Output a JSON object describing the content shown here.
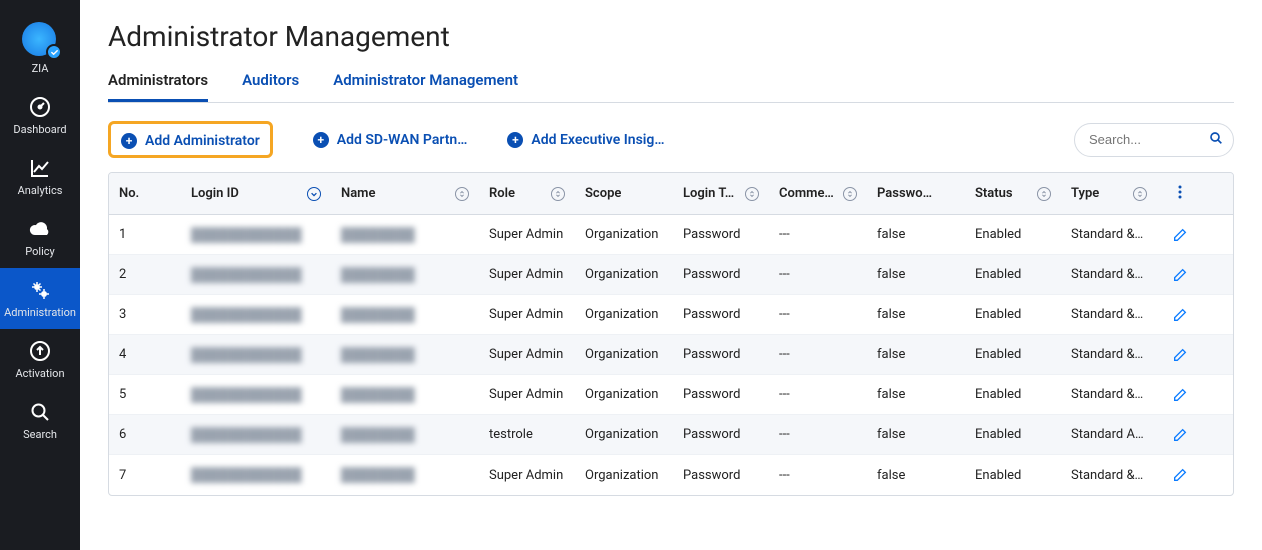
{
  "brand": "ZIA",
  "sidebar": [
    {
      "key": "zia",
      "label": "ZIA",
      "icon": "globe-check-icon",
      "active": false
    },
    {
      "key": "dashboard",
      "label": "Dashboard",
      "icon": "gauge-icon",
      "active": false
    },
    {
      "key": "analytics",
      "label": "Analytics",
      "icon": "chart-line-icon",
      "active": false
    },
    {
      "key": "policy",
      "label": "Policy",
      "icon": "cloud-icon",
      "active": false
    },
    {
      "key": "administration",
      "label": "Administration",
      "icon": "gears-icon",
      "active": true
    },
    {
      "key": "activation",
      "label": "Activation",
      "icon": "upload-circle-icon",
      "active": false
    },
    {
      "key": "search",
      "label": "Search",
      "icon": "search-icon",
      "active": false
    }
  ],
  "page_title": "Administrator Management",
  "tabs": [
    {
      "key": "administrators",
      "label": "Administrators",
      "active": true
    },
    {
      "key": "auditors",
      "label": "Auditors",
      "active": false
    },
    {
      "key": "admin_mgmt",
      "label": "Administrator Management",
      "active": false
    }
  ],
  "actions": {
    "add_admin": "Add Administrator",
    "add_sdwan": "Add SD-WAN Partn…",
    "add_exec": "Add Executive Insig…"
  },
  "search": {
    "placeholder": "Search..."
  },
  "columns": [
    {
      "key": "no",
      "label": "No."
    },
    {
      "key": "login_id",
      "label": "Login ID",
      "sort": "down"
    },
    {
      "key": "name",
      "label": "Name",
      "sort": "neutral"
    },
    {
      "key": "role",
      "label": "Role",
      "sort": "neutral"
    },
    {
      "key": "scope",
      "label": "Scope"
    },
    {
      "key": "login_t",
      "label": "Login T…",
      "sort": "neutral"
    },
    {
      "key": "comme",
      "label": "Comme…",
      "sort": "neutral"
    },
    {
      "key": "passwo",
      "label": "Passwo…"
    },
    {
      "key": "status",
      "label": "Status",
      "sort": "neutral"
    },
    {
      "key": "type",
      "label": "Type",
      "sort": "neutral"
    }
  ],
  "rows": [
    {
      "no": "1",
      "login_id": "████████████",
      "name": "████████",
      "role": "Super Admin",
      "scope": "Organization",
      "login_t": "Password",
      "comme": "---",
      "passwo": "false",
      "status": "Enabled",
      "type": "Standard &…"
    },
    {
      "no": "2",
      "login_id": "████████████",
      "name": "████████",
      "role": "Super Admin",
      "scope": "Organization",
      "login_t": "Password",
      "comme": "---",
      "passwo": "false",
      "status": "Enabled",
      "type": "Standard &…"
    },
    {
      "no": "3",
      "login_id": "████████████",
      "name": "████████",
      "role": "Super Admin",
      "scope": "Organization",
      "login_t": "Password",
      "comme": "---",
      "passwo": "false",
      "status": "Enabled",
      "type": "Standard &…"
    },
    {
      "no": "4",
      "login_id": "████████████",
      "name": "████████",
      "role": "Super Admin",
      "scope": "Organization",
      "login_t": "Password",
      "comme": "---",
      "passwo": "false",
      "status": "Enabled",
      "type": "Standard &…"
    },
    {
      "no": "5",
      "login_id": "████████████",
      "name": "████████",
      "role": "Super Admin",
      "scope": "Organization",
      "login_t": "Password",
      "comme": "---",
      "passwo": "false",
      "status": "Enabled",
      "type": "Standard &…"
    },
    {
      "no": "6",
      "login_id": "████████████",
      "name": "████████",
      "role": "testrole",
      "scope": "Organization",
      "login_t": "Password",
      "comme": "---",
      "passwo": "false",
      "status": "Enabled",
      "type": "Standard A…"
    },
    {
      "no": "7",
      "login_id": "████████████",
      "name": "████████",
      "role": "Super Admin",
      "scope": "Organization",
      "login_t": "Password",
      "comme": "---",
      "passwo": "false",
      "status": "Enabled",
      "type": "Standard &…"
    }
  ]
}
